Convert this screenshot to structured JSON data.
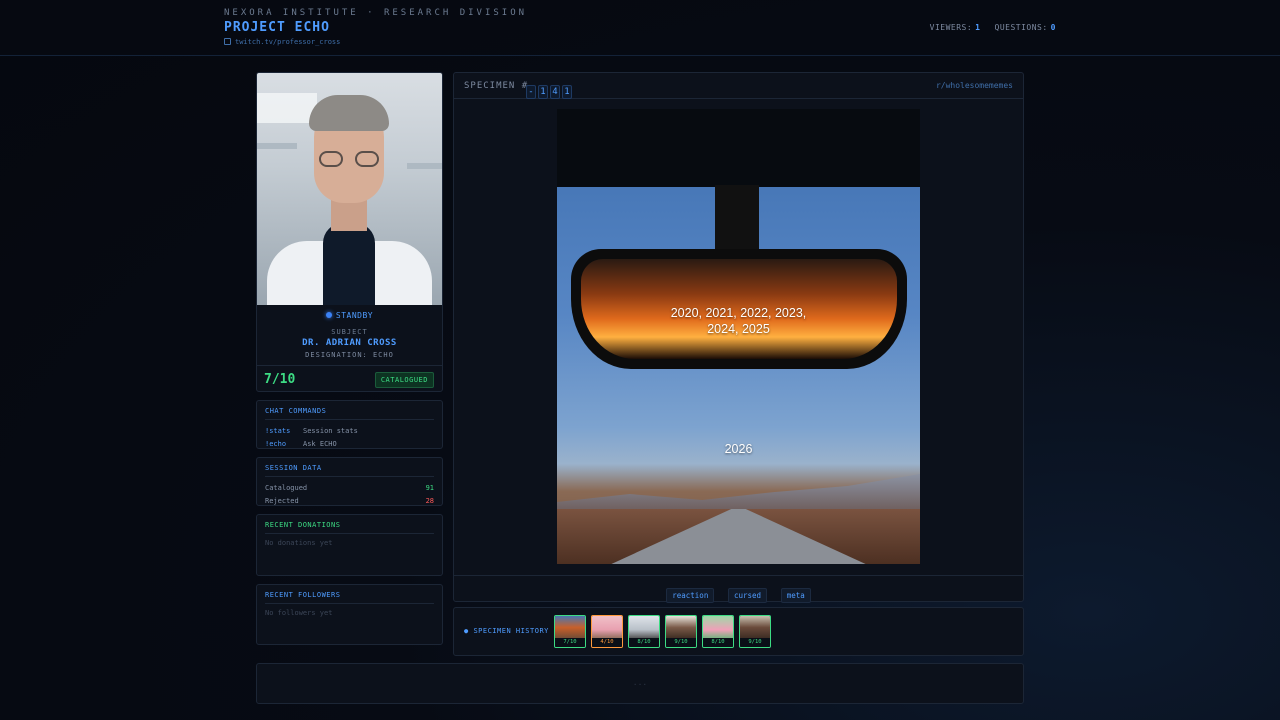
{
  "header": {
    "org": "NEXORA INSTITUTE · RESEARCH DIVISION",
    "project": "PROJECT ECHO",
    "twitch": "twitch.tv/professor_cross",
    "viewers_label": "VIEWERS:",
    "viewers": "1",
    "questions_label": "QUESTIONS:",
    "questions": "0"
  },
  "profile": {
    "status": "STANDBY",
    "subject_label": "SUBJECT",
    "name": "DR. ADRIAN CROSS",
    "designation": "DESIGNATION: ECHO",
    "score": "7/10",
    "badge": "CATALOGUED"
  },
  "chat_commands": {
    "title": "CHAT COMMANDS",
    "items": [
      {
        "cmd": "!stats",
        "desc": "Session stats"
      },
      {
        "cmd": "!echo",
        "desc": "Ask ECHO"
      }
    ]
  },
  "session": {
    "title": "SESSION DATA",
    "catalogued_label": "Catalogued",
    "catalogued": "91",
    "rejected_label": "Rejected",
    "rejected": "28"
  },
  "donations": {
    "title": "RECENT DONATIONS",
    "empty": "No donations yet"
  },
  "followers": {
    "title": "RECENT FOLLOWERS",
    "empty": "No followers yet"
  },
  "specimen": {
    "label": "SPECIMEN #",
    "digits": [
      "-",
      "1",
      "4",
      "1"
    ],
    "subreddit": "r/wholesomememes",
    "meme_text_top_line1": "2020, 2021, 2022, 2023,",
    "meme_text_top_line2": "2024, 2025",
    "meme_text_bottom": "2026",
    "tags": [
      "reaction",
      "cursed",
      "meta"
    ]
  },
  "history": {
    "label": "SPECIMEN HISTORY",
    "items": [
      {
        "score": "7/10",
        "color": "green"
      },
      {
        "score": "4/10",
        "color": "orange"
      },
      {
        "score": "8/10",
        "color": "green"
      },
      {
        "score": "9/10",
        "color": "green"
      },
      {
        "score": "8/10",
        "color": "green"
      },
      {
        "score": "9/10",
        "color": "green"
      }
    ]
  },
  "footer": {
    "placeholder": "..."
  },
  "colors": {
    "accent": "#4f9cff",
    "positive": "#3ddc84",
    "negative": "#ff5a5a",
    "warning": "#ff9a3c"
  }
}
